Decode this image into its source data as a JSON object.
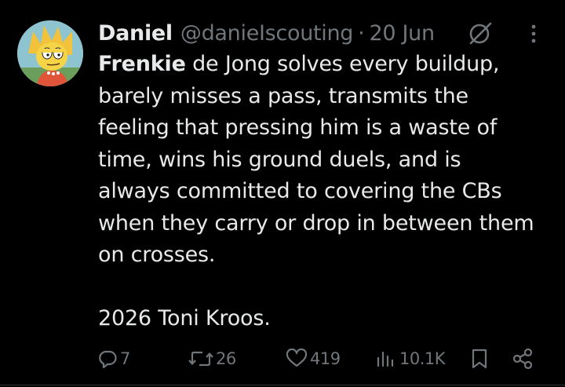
{
  "tweet": {
    "author": {
      "name": "Daniel",
      "handle": "@danieIscouting",
      "separator": "·",
      "date": "20 Jun"
    },
    "body": {
      "first_word": "Frenkie",
      "line1_rest": " de Jong solves every buildup,",
      "lines": [
        "barely misses a pass, transmits the",
        "feeling that pressing him is a waste of",
        "time, wins his ground duels, and is",
        "always committed to covering the CBs",
        "when they carry or drop in between them",
        "on crosses."
      ],
      "closing": "2026 Toni Kroos."
    },
    "actions": {
      "replies": "7",
      "reposts": "26",
      "likes": "419",
      "views": "10.1K"
    },
    "icons": {
      "grok": "grok-icon",
      "more": "more-icon",
      "reply": "reply-icon",
      "repost": "repost-icon",
      "like": "heart-icon",
      "views": "views-icon",
      "bookmark": "bookmark-icon",
      "share": "share-icon"
    },
    "colors": {
      "background": "#000000",
      "text": "#e7e9ea",
      "muted": "#71767b"
    }
  }
}
